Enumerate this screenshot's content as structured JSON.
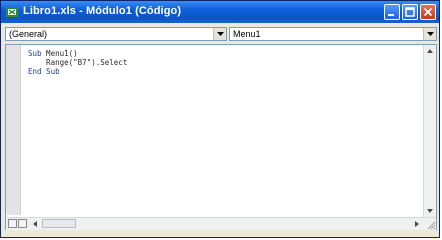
{
  "window": {
    "title": "Libro1.xls - Módulo1 (Código)",
    "colors": {
      "titlebar": "#0b5fd8",
      "close": "#c23c22"
    }
  },
  "toolbar": {
    "object_combo": {
      "value": "(General)"
    },
    "procedure_combo": {
      "value": "Menu1"
    }
  },
  "editor": {
    "code_lines": [
      {
        "keyword": "Sub",
        "text": " Menu1()"
      },
      {
        "keyword": "",
        "text": "    Range(\"B7\").Select"
      },
      {
        "keyword": "End Sub",
        "text": ""
      }
    ]
  },
  "icons": [
    "excel-app-icon",
    "minimize-icon",
    "maximize-icon",
    "close-icon",
    "chevron-down-icon",
    "scroll-up-icon",
    "scroll-down-icon",
    "scroll-left-icon",
    "scroll-right-icon",
    "procedure-view-icon",
    "full-module-view-icon",
    "resize-grip-icon"
  ]
}
